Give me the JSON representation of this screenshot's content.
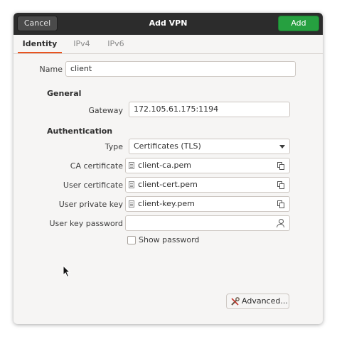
{
  "window": {
    "title": "Add VPN",
    "cancel_label": "Cancel",
    "add_label": "Add"
  },
  "tabs": [
    {
      "label": "Identity",
      "active": true
    },
    {
      "label": "IPv4",
      "active": false
    },
    {
      "label": "IPv6",
      "active": false
    }
  ],
  "identity": {
    "name_label": "Name",
    "name_value": "client",
    "general_heading": "General",
    "gateway_label": "Gateway",
    "gateway_value": "172.105.61.175:1194",
    "auth_heading": "Authentication",
    "type_label": "Type",
    "type_value": "Certificates (TLS)",
    "ca_label": "CA certificate",
    "ca_value": "client-ca.pem",
    "user_cert_label": "User certificate",
    "user_cert_value": "client-cert.pem",
    "user_key_label": "User private key",
    "user_key_value": "client-key.pem",
    "user_key_password_label": "User key password",
    "user_key_password_value": "",
    "show_password_label": "Show password",
    "show_password_checked": false,
    "advanced_label": "Advanced..."
  },
  "colors": {
    "titlebar": "#2c2c2c",
    "add_button": "#26a040",
    "accent": "#e95420"
  },
  "icons": {
    "file": "file-icon",
    "copy": "copy-icon",
    "person": "person-icon",
    "tools": "tools-icon",
    "dropdown": "chevron-down-icon"
  }
}
